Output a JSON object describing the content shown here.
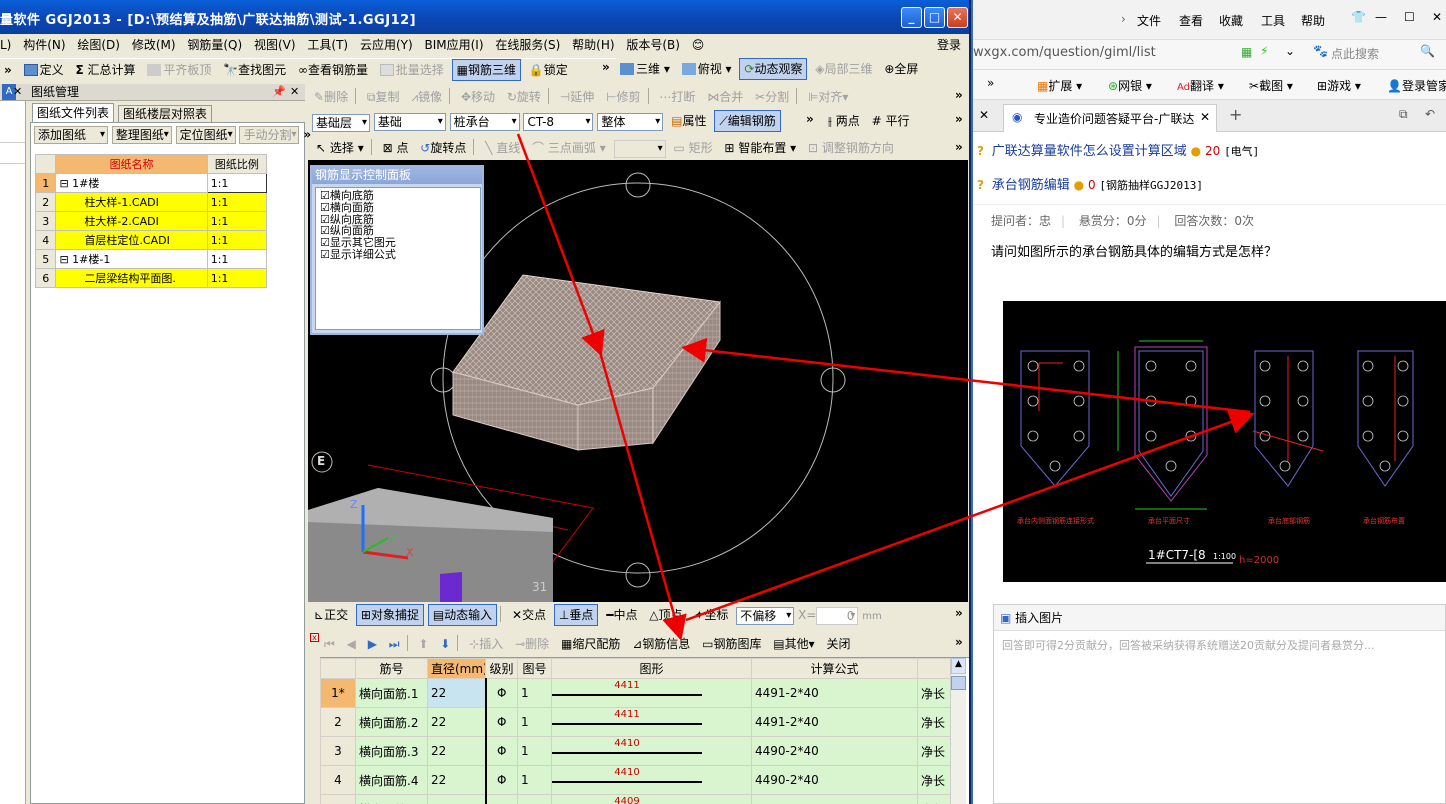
{
  "app": {
    "title": "量软件 GGJ2013 - [D:\\预结算及抽筋\\广联达抽筋\\测试-1.GGJ12]",
    "login": "登录",
    "menu": [
      "L)",
      "构件(N)",
      "绘图(D)",
      "修改(M)",
      "钢筋量(Q)",
      "视图(V)",
      "工具(T)",
      "云应用(Y)",
      "BIM应用(I)",
      "在线服务(S)",
      "帮助(H)",
      "版本号(B)"
    ],
    "toolbar1": {
      "left": [
        "定义",
        "汇总计算",
        "平齐板顶",
        "查找图元",
        "查看钢筋量",
        "批量选择",
        "钢筋三维",
        "锁定"
      ],
      "right": [
        "三维",
        "俯视",
        "动态观察",
        "局部三维",
        "全屏"
      ]
    },
    "toolbar2": [
      "删除",
      "复制",
      "镜像",
      "移动",
      "旋转",
      "延伸",
      "修剪",
      "打断",
      "合并",
      "分割",
      "对齐"
    ],
    "toolbar3": {
      "combos": [
        "基础层",
        "基础",
        "桩承台",
        "CT-8",
        "整体"
      ],
      "buttons": [
        "属性",
        "编辑钢筋",
        "两点",
        "平行"
      ]
    },
    "toolbar4": [
      "选择",
      "点",
      "旋转点",
      "直线",
      "三点画弧",
      "矩形",
      "智能布置",
      "调整钢筋方向"
    ],
    "snapbar": [
      "正交",
      "对象捕捉",
      "动态输入",
      "交点",
      "垂点",
      "中点",
      "顶点",
      "坐标"
    ],
    "snapcombo": "不偏移",
    "snap_x_label": "X=",
    "snap_x_value": "0",
    "snap_unit": "mm",
    "rebarbar": [
      "插入",
      "删除",
      "缩尺配筋",
      "钢筋信息",
      "钢筋图库",
      "其他",
      "关闭"
    ]
  },
  "left_panel": {
    "title": "图纸管理",
    "tabs": [
      "图纸文件列表",
      "图纸楼层对照表"
    ],
    "buttons": [
      "添加图纸",
      "整理图纸",
      "定位图纸",
      "手动分割"
    ],
    "columns": [
      "图纸名称",
      "图纸比例"
    ],
    "rows": [
      {
        "n": "1",
        "name": "1#楼",
        "scale": "1:1",
        "group": true
      },
      {
        "n": "2",
        "name": "柱大样-1.CADI",
        "scale": "1:1",
        "group": false
      },
      {
        "n": "3",
        "name": "柱大样-2.CADI",
        "scale": "1:1",
        "group": false
      },
      {
        "n": "4",
        "name": "首层柱定位.CADI",
        "scale": "1:1",
        "group": false
      },
      {
        "n": "5",
        "name": "1#楼-1",
        "scale": "1:1",
        "group": true
      },
      {
        "n": "6",
        "name": "二层梁结构平面图.",
        "scale": "1:1",
        "group": false
      }
    ]
  },
  "rebar_panel": {
    "title": "钢筋显示控制面板",
    "items": [
      "横向底筋",
      "横向面筋",
      "纵向底筋",
      "纵向面筋",
      "显示其它图元",
      "显示详细公式"
    ]
  },
  "viewport": {
    "axis_label": "E",
    "bottom_text": "31"
  },
  "rebar_table": {
    "columns": [
      "筋号",
      "直径(mm)",
      "级别",
      "图号",
      "图形",
      "计算公式",
      ""
    ],
    "rows": [
      {
        "n": "1*",
        "name": "横向面筋.1",
        "dia": "22",
        "grade": "Φ",
        "fig": "1",
        "len": "4411",
        "formula": "4491-2*40",
        "extra": "净长"
      },
      {
        "n": "2",
        "name": "横向面筋.2",
        "dia": "22",
        "grade": "Φ",
        "fig": "1",
        "len": "4411",
        "formula": "4491-2*40",
        "extra": "净长"
      },
      {
        "n": "3",
        "name": "横向面筋.3",
        "dia": "22",
        "grade": "Φ",
        "fig": "1",
        "len": "4410",
        "formula": "4490-2*40",
        "extra": "净长"
      },
      {
        "n": "4",
        "name": "横向面筋.4",
        "dia": "22",
        "grade": "Φ",
        "fig": "1",
        "len": "4410",
        "formula": "4490-2*40",
        "extra": "净长"
      },
      {
        "n": "",
        "name": "横向面筋",
        "dia": "",
        "grade": "Φ",
        "fig": "",
        "len": "4409",
        "formula": "",
        "extra": "净长"
      }
    ]
  },
  "browser": {
    "menu": [
      "文件",
      "查看",
      "收藏",
      "工具",
      "帮助"
    ],
    "url": "wxgx.com/question/giml/list",
    "search_placeholder": "点此搜索",
    "favbar": [
      "扩展",
      "网银",
      "翻译",
      "截图",
      "游戏",
      "登录管家"
    ],
    "tab": "专业造价问题答疑平台-广联达",
    "questions": [
      {
        "title": "广联达算量软件怎么设置计算区域",
        "coins": "20",
        "tag": "[电气]"
      },
      {
        "title": "承台钢筋编辑",
        "coins": "0",
        "tag": "[钢筋抽样GGJ2013]"
      }
    ],
    "meta": {
      "asker": "提问者：忠",
      "bounty": "悬赏分：0分",
      "answers": "回答次数：0次"
    },
    "question_text": "请问如图所示的承台钢筋具体的编辑方式是怎样？",
    "cad_title": "1#CT7-[8",
    "cad_scale": "1:100",
    "cad_h": "h=2000",
    "cad_labels": [
      "承台内侧面钢筋连接形式",
      "承台平面尺寸",
      "承台底部钢筋",
      "承台钢筋布置"
    ],
    "insert_image": "插入图片",
    "answer_placeholder": "回答即可得2分贡献分，回答被采纳获得系统赠送20贡献分及提问者悬赏分..."
  }
}
